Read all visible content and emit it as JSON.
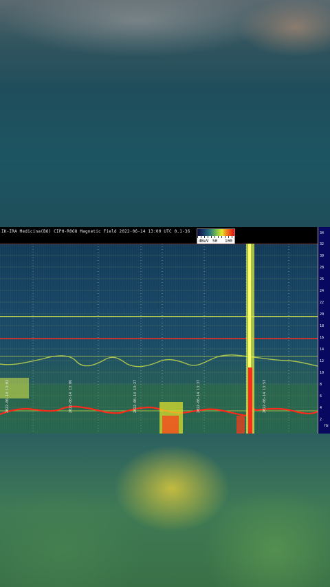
{
  "header": {
    "title": "IK-IRA Medicina(BO) CIPH-R0G8 Magnetic Field 2022-06-14 13:00 UTC 0.1-36",
    "colorbar_unit": "dBuV",
    "colorbar_mid": "50",
    "colorbar_max": "100"
  },
  "axis": {
    "unit": "Hz",
    "ticks": [
      "34",
      "32",
      "30",
      "28",
      "26",
      "24",
      "22",
      "20",
      "18",
      "16",
      "14",
      "12",
      "10",
      "8",
      "6",
      "4",
      "2"
    ]
  },
  "time_labels": [
    "2022-06-14 13:02",
    "2022-06-14 13:06",
    "2022-06-14 13:27",
    "2022-06-14 13:37",
    "2022-06-14 13:53"
  ],
  "colors": {
    "hum_line": "#ff2a1a",
    "harmonic": "#d8e84a",
    "axis_bg": "#080860"
  }
}
